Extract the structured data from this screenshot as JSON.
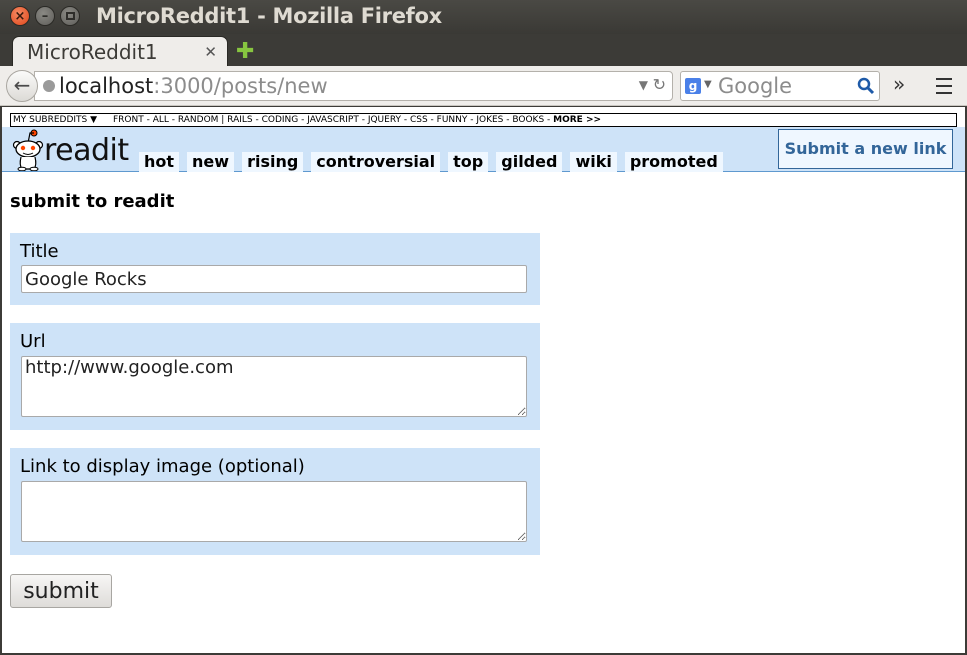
{
  "window": {
    "title": "MicroReddit1 - Mozilla Firefox"
  },
  "browser": {
    "tab_label": "MicroReddit1",
    "url_host": "localhost",
    "url_rest": ":3000/posts/new",
    "search_placeholder": "Google"
  },
  "site": {
    "subreddit_bar": {
      "my_subreddits": "MY SUBREDDITS ▼",
      "list": "FRONT - ALL - RANDOM | RAILS - CODING - JAVASCRIPT - JQUERY - CSS - FUNNY - JOKES - BOOKS - ",
      "more": "MORE >>"
    },
    "logo_text": "readit",
    "tabs": [
      "hot",
      "new",
      "rising",
      "controversial",
      "top",
      "gilded",
      "wiki",
      "promoted"
    ],
    "submit_link_label": "Submit a new link"
  },
  "form": {
    "heading": "submit to readit",
    "title_label": "Title",
    "title_value": "Google Rocks",
    "url_label": "Url",
    "url_value": "http://www.google.com",
    "image_label": "Link to display image (optional)",
    "image_value": "",
    "submit_label": "submit"
  },
  "colors": {
    "header_bg": "#cee3f8",
    "field_bg": "#cee3f8",
    "link_color": "#336699"
  }
}
